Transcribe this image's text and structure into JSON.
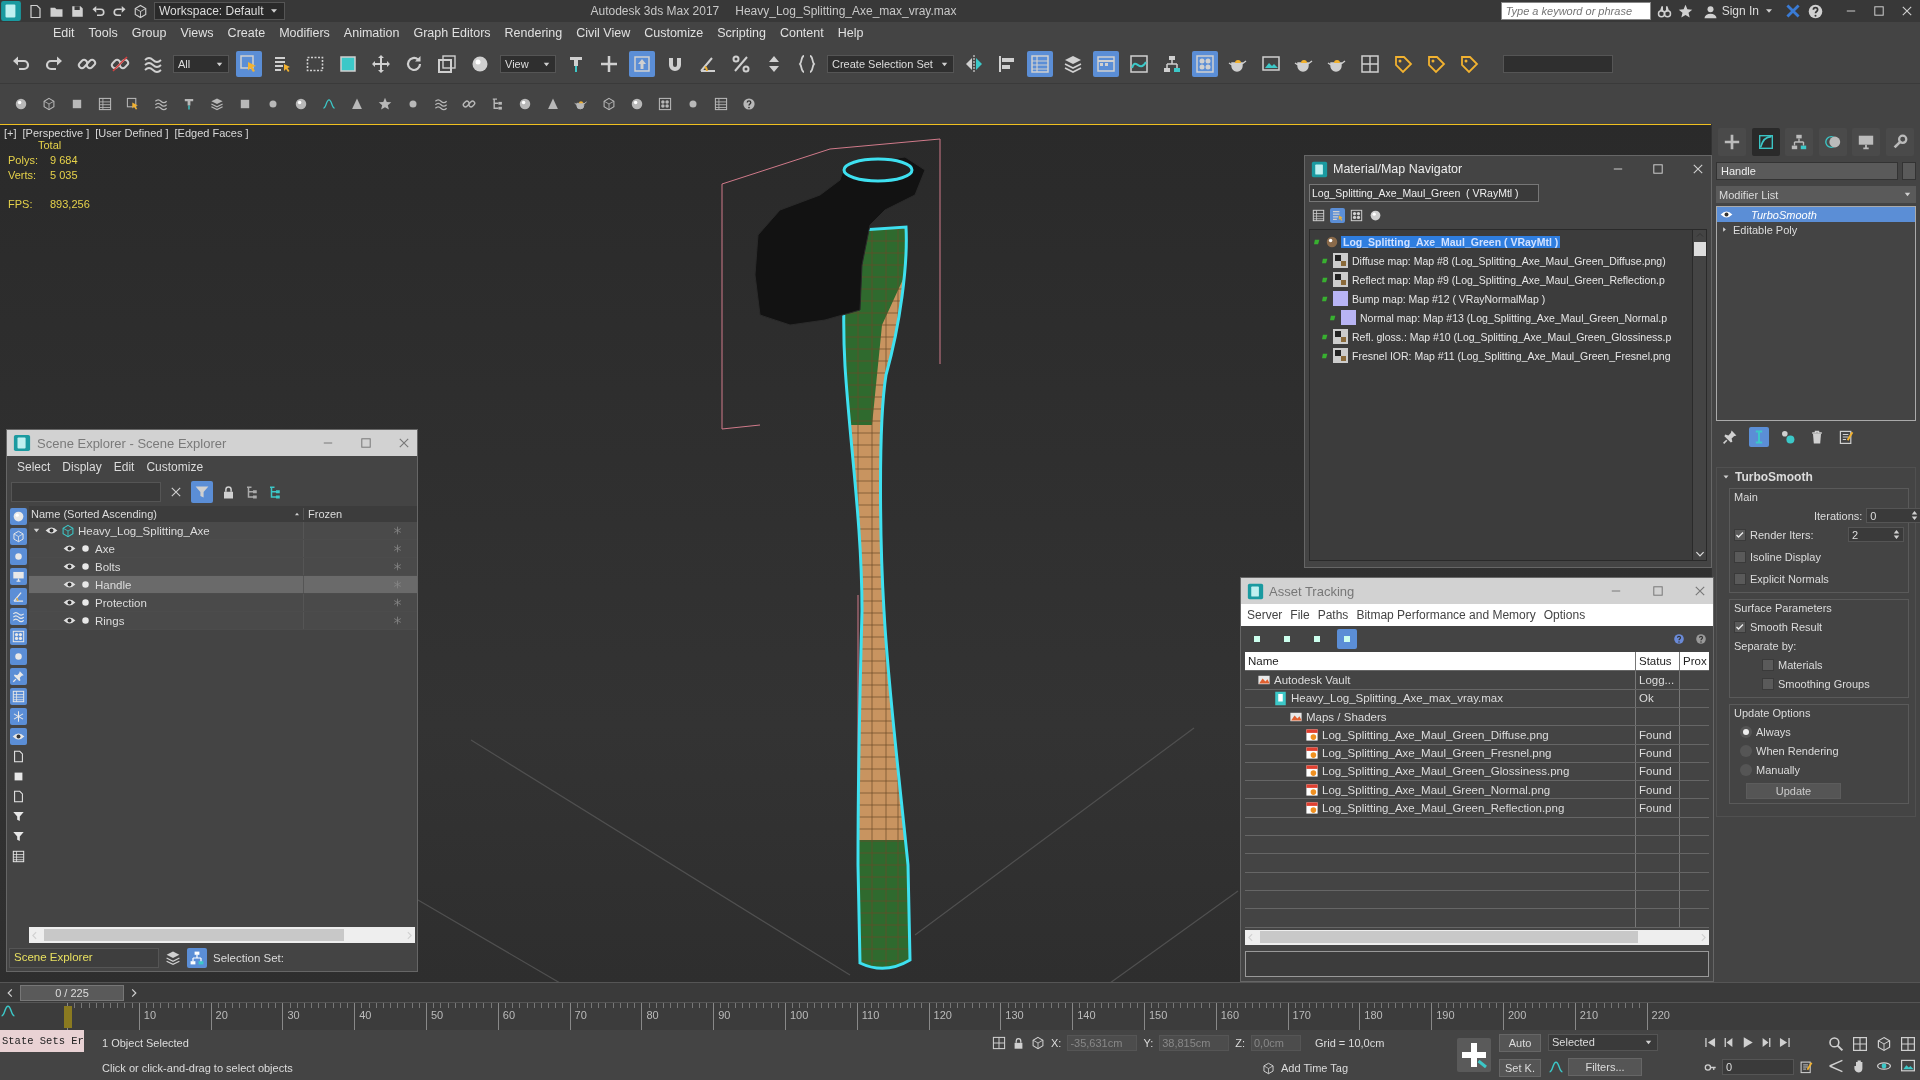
{
  "title_bar": {
    "workspace": "Workspace: Default",
    "app_title": "Autodesk 3ds Max 2017",
    "file_name": "Heavy_Log_Splitting_Axe_max_vray.max",
    "search": {
      "placeholder": "Type a keyword or phrase"
    },
    "sign_in": "Sign In"
  },
  "menu": [
    "Edit",
    "Tools",
    "Group",
    "Views",
    "Create",
    "Modifiers",
    "Animation",
    "Graph Editors",
    "Rendering",
    "Civil View",
    "Customize",
    "Scripting",
    "Content",
    "Help"
  ],
  "main_toolbar": [
    {
      "kind": "icon",
      "on": false
    },
    {
      "kind": "icon",
      "on": false
    },
    {
      "kind": "icon",
      "on": false
    },
    {
      "kind": "icon",
      "on": false
    },
    {
      "kind": "icon",
      "on": false
    },
    {
      "kind": "dropdown",
      "value": "All"
    },
    {
      "kind": "icon",
      "on": true
    },
    {
      "kind": "icon",
      "on": false
    },
    {
      "kind": "icon",
      "on": false
    },
    {
      "kind": "icon",
      "on": false
    },
    {
      "kind": "icon",
      "on": false
    },
    {
      "kind": "icon",
      "on": false
    },
    {
      "kind": "icon",
      "on": false
    },
    {
      "kind": "icon",
      "on": false
    },
    {
      "kind": "dropdown",
      "value": "View"
    },
    {
      "kind": "icon",
      "on": false
    },
    {
      "kind": "icon",
      "on": false
    },
    {
      "kind": "icon",
      "on": true
    },
    {
      "kind": "icon",
      "on": false
    },
    {
      "kind": "icon",
      "on": false
    },
    {
      "kind": "icon",
      "on": false
    },
    {
      "kind": "icon",
      "on": false
    },
    {
      "kind": "icon",
      "on": false
    },
    {
      "kind": "dropdown",
      "value": "Create Selection Set"
    },
    {
      "kind": "icon",
      "on": false
    },
    {
      "kind": "icon",
      "on": false
    },
    {
      "kind": "icon",
      "on": true
    },
    {
      "kind": "icon",
      "on": false
    },
    {
      "kind": "icon",
      "on": true
    },
    {
      "kind": "icon",
      "on": false
    },
    {
      "kind": "icon",
      "on": false
    },
    {
      "kind": "icon",
      "on": true
    },
    {
      "kind": "icon",
      "on": false
    },
    {
      "kind": "icon",
      "on": false
    },
    {
      "kind": "icon",
      "on": false
    },
    {
      "kind": "icon",
      "on": false
    },
    {
      "kind": "icon",
      "on": false
    },
    {
      "kind": "icon",
      "on": false
    },
    {
      "kind": "icon",
      "on": false
    },
    {
      "kind": "icon",
      "on": false
    }
  ],
  "viewport": {
    "labels": [
      "[+]",
      "[Perspective ]",
      "[User Defined ]",
      "[Edged Faces ]"
    ],
    "stats_header": "Total",
    "stats": [
      {
        "label": "Polys:",
        "value": "9 684"
      },
      {
        "label": "Verts:",
        "value": "5 035"
      },
      {
        "label": "FPS:",
        "value": "893,256"
      }
    ]
  },
  "scene_explorer": {
    "title": "Scene Explorer - Scene Explorer",
    "menu": [
      "Select",
      "Display",
      "Edit",
      "Customize"
    ],
    "columns": [
      "Name (Sorted Ascending)",
      "Frozen"
    ],
    "display_filters": [
      {
        "on": true
      },
      {
        "on": true
      },
      {
        "on": true
      },
      {
        "on": true
      },
      {
        "on": true
      },
      {
        "on": true
      },
      {
        "on": true
      },
      {
        "on": true
      },
      {
        "on": true
      },
      {
        "on": true
      },
      {
        "on": true
      },
      {
        "on": true
      },
      {
        "on": false
      },
      {
        "on": false
      },
      {
        "on": false
      },
      {
        "on": false
      },
      {
        "on": false
      },
      {
        "on": false
      }
    ],
    "tree": [
      {
        "name": "Heavy_Log_Splitting_Axe",
        "selected": false,
        "expanded": true,
        "children": [
          {
            "name": "Axe",
            "selected": false
          },
          {
            "name": "Bolts",
            "selected": false
          },
          {
            "name": "Handle",
            "selected": true
          },
          {
            "name": "Protection",
            "selected": false
          },
          {
            "name": "Rings",
            "selected": false
          }
        ]
      }
    ],
    "explorer": "Scene Explorer",
    "selection_set": "Selection Set:"
  },
  "material_navigator": {
    "title": "Material/Map Navigator",
    "material": "Log_Splitting_Axe_Maul_Green  ( VRayMtl )",
    "view_modes": [
      {
        "selected": false
      },
      {
        "selected": true
      },
      {
        "selected": false
      },
      {
        "selected": false
      }
    ],
    "tree": [
      {
        "label": "Log_Splitting_Axe_Maul_Green  ( VRayMtl )",
        "kind": "material",
        "selected": true,
        "children": [
          {
            "label": "Diffuse map: Map #8 (Log_Splitting_Axe_Maul_Green_Diffuse.png)",
            "kind": "texture",
            "selected": false
          },
          {
            "label": "Reflect map: Map #9 (Log_Splitting_Axe_Maul_Green_Reflection.p",
            "kind": "texture",
            "selected": false
          },
          {
            "label": "Bump map: Map #12  ( VRayNormalMap )",
            "kind": "normal",
            "selected": false,
            "children": [
              {
                "label": "Normal map: Map #13 (Log_Splitting_Axe_Maul_Green_Normal.p",
                "kind": "normal",
                "selected": false
              }
            ]
          },
          {
            "label": "Refl. gloss.: Map #10 (Log_Splitting_Axe_Maul_Green_Glossiness.p",
            "kind": "texture",
            "selected": false
          },
          {
            "label": "Fresnel IOR: Map #11 (Log_Splitting_Axe_Maul_Green_Fresnel.png",
            "kind": "texture",
            "selected": false
          }
        ]
      }
    ]
  },
  "asset_tracking": {
    "title": "Asset Tracking",
    "menu": [
      "Server",
      "File",
      "Paths",
      "Bitmap Performance and Memory",
      "Options"
    ],
    "tools": [
      {
        "on": false
      },
      {
        "on": false
      },
      {
        "on": false
      },
      {
        "on": true
      }
    ],
    "columns": [
      "Name",
      "Status",
      "Prox"
    ],
    "rows": [
      {
        "name": "Autodesk Vault",
        "status": "Logg...",
        "kind": "vault",
        "children": [
          {
            "name": "Heavy_Log_Splitting_Axe_max_vray.max",
            "status": "Ok",
            "kind": "max",
            "children": [
              {
                "name": "Maps / Shaders",
                "kind": "folder",
                "children": [
                  {
                    "name": "Log_Splitting_Axe_Maul_Green_Diffuse.png",
                    "status": "Found",
                    "kind": "image"
                  },
                  {
                    "name": "Log_Splitting_Axe_Maul_Green_Fresnel.png",
                    "status": "Found",
                    "kind": "image"
                  },
                  {
                    "name": "Log_Splitting_Axe_Maul_Green_Glossiness.png",
                    "status": "Found",
                    "kind": "image"
                  },
                  {
                    "name": "Log_Splitting_Axe_Maul_Green_Normal.png",
                    "status": "Found",
                    "kind": "image"
                  },
                  {
                    "name": "Log_Splitting_Axe_Maul_Green_Reflection.png",
                    "status": "Found",
                    "kind": "image"
                  }
                ]
              }
            ]
          }
        ]
      }
    ]
  },
  "command_panel": {
    "tabs": [
      {
        "selected": false
      },
      {
        "selected": true
      },
      {
        "selected": false
      },
      {
        "selected": false
      },
      {
        "selected": false
      },
      {
        "selected": false
      }
    ],
    "object_name": "Handle",
    "modifier_list": "Modifier List",
    "stack": [
      {
        "name": "TurboSmooth",
        "selected": true
      },
      {
        "name": "Editable Poly",
        "selected": false
      }
    ],
    "stack_tools": [
      {
        "on": false
      },
      {
        "on": true
      },
      {
        "on": false
      },
      {
        "on": false
      },
      {
        "on": false
      }
    ],
    "rollout": {
      "title": "TurboSmooth",
      "groups": [
        {
          "title": "Main",
          "items": [
            {
              "kind": "spinner",
              "label": "Iterations:",
              "value": "0"
            },
            {
              "kind": "check_spinner",
              "label": "Render Iters:",
              "checked": true,
              "value": "2"
            },
            {
              "kind": "checkbox",
              "label": "Isoline Display",
              "checked": false
            },
            {
              "kind": "checkbox",
              "label": "Explicit Normals",
              "checked": false
            }
          ]
        },
        {
          "title": "Surface Parameters",
          "items": [
            {
              "kind": "checkbox",
              "label": "Smooth Result",
              "checked": true
            },
            {
              "kind": "label",
              "label": "Separate by:"
            },
            {
              "kind": "sub_checkbox",
              "label": "Materials",
              "checked": false
            },
            {
              "kind": "sub_checkbox",
              "label": "Smoothing Groups",
              "checked": false
            }
          ]
        },
        {
          "title": "Update Options",
          "items": [
            {
              "kind": "radio",
              "label": "Always",
              "selected": true
            },
            {
              "kind": "radio",
              "label": "When Rendering",
              "selected": false
            },
            {
              "kind": "radio",
              "label": "Manually",
              "selected": false
            },
            {
              "kind": "button",
              "label": "Update"
            }
          ]
        }
      ]
    }
  },
  "timeline": {
    "position": "0 / 225",
    "level": 0,
    "ruler": [
      "10",
      "20",
      "30",
      "40",
      "50",
      "60",
      "70",
      "80",
      "90",
      "100",
      "110",
      "120",
      "130",
      "140",
      "150",
      "160",
      "170",
      "180",
      "190",
      "200",
      "210",
      "220"
    ]
  },
  "status_bar": {
    "listener": "State Sets Er",
    "selection": "1 Object Selected",
    "prompt": "Click or click-and-drag to select objects",
    "coords": [
      {
        "axis": "X:",
        "value": "-35,631cm",
        "disabled": true
      },
      {
        "axis": "Y:",
        "value": "38,815cm",
        "disabled": true
      },
      {
        "axis": "Z:",
        "value": "0,0cm",
        "disabled": true
      }
    ],
    "grid": "Grid = 10,0cm",
    "add_time_tag": "Add Time Tag",
    "auto_key": "Auto",
    "set_key": "Set K.",
    "key_filter": "Selected",
    "filters": "Filters...",
    "frame": "0"
  }
}
